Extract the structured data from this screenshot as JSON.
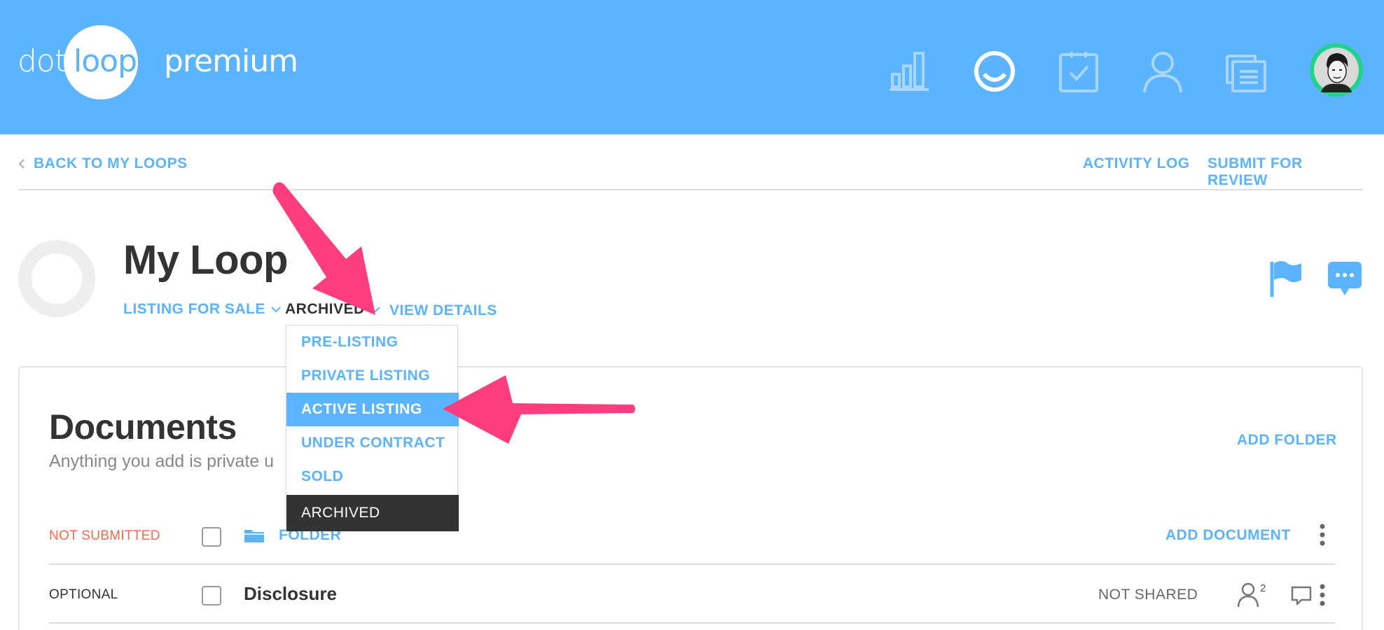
{
  "header": {
    "logo": {
      "dot": "dot",
      "loop": "loop",
      "premium": "premium"
    },
    "icons": [
      "chart-icon",
      "smile-icon",
      "tasks-icon",
      "person-icon",
      "documents-icon",
      "avatar"
    ],
    "colors": {
      "brand": "#5cb3ff",
      "avatar_ring": "#1fd48a"
    }
  },
  "subnav": {
    "back_label": "BACK TO MY LOOPS",
    "activity_log": "ACTIVITY LOG",
    "submit_for_review": "SUBMIT FOR REVIEW"
  },
  "loop": {
    "title": "My Loop",
    "transaction_type": "LISTING FOR SALE",
    "status": "ARCHIVED",
    "view_details": "VIEW DETAILS"
  },
  "status_dropdown": {
    "options": [
      {
        "label": "PRE-LISTING",
        "state": "normal"
      },
      {
        "label": "PRIVATE LISTING",
        "state": "normal"
      },
      {
        "label": "ACTIVE LISTING",
        "state": "highlighted"
      },
      {
        "label": "UNDER CONTRACT",
        "state": "normal"
      },
      {
        "label": "SOLD",
        "state": "normal"
      },
      {
        "label": "ARCHIVED",
        "state": "selected"
      }
    ]
  },
  "documents": {
    "title": "Documents",
    "subtitle": "Anything you add is private u",
    "add_folder": "ADD FOLDER",
    "rows": [
      {
        "status": "NOT SUBMITTED",
        "name": "FOLDER",
        "action": "ADD DOCUMENT"
      },
      {
        "status": "OPTIONAL",
        "name": "Disclosure",
        "share_status": "NOT SHARED",
        "people_count": "2"
      }
    ]
  },
  "annotations": {
    "arrow_color": "#ff3d7f"
  }
}
